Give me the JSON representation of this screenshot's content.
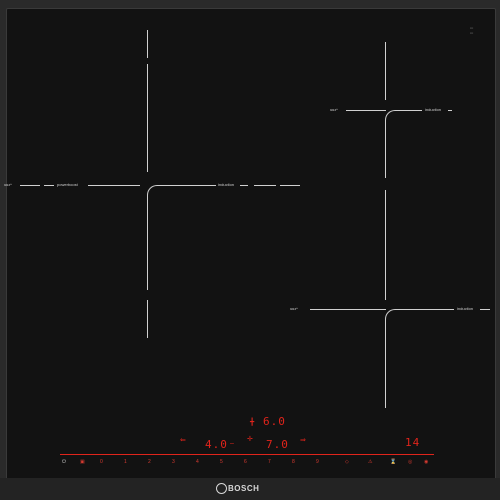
{
  "brand": "BOSCH",
  "zones": {
    "left": {
      "left_label": "ᴜʀᴊ^",
      "mid_label": "powerboost",
      "right_label": "induction"
    },
    "top_right": {
      "left_label": "ᴜʀᴊ^",
      "right_label": "induction"
    },
    "bottom_right": {
      "left_label": "ᴜʀᴊ^",
      "right_label": "induction"
    }
  },
  "display": {
    "top_value": "6.0",
    "left_value": "4.0",
    "center_value": "7.0",
    "right_value": "14"
  },
  "slider_marks": [
    "0",
    "1",
    "2",
    "3",
    "4",
    "5",
    "6",
    "7",
    "8",
    "9"
  ],
  "colors": {
    "accent": "#e0241b",
    "glass": "#121212"
  },
  "icons": [
    "power-icon",
    "child-lock-icon",
    "timer-icon",
    "warning-icon"
  ]
}
